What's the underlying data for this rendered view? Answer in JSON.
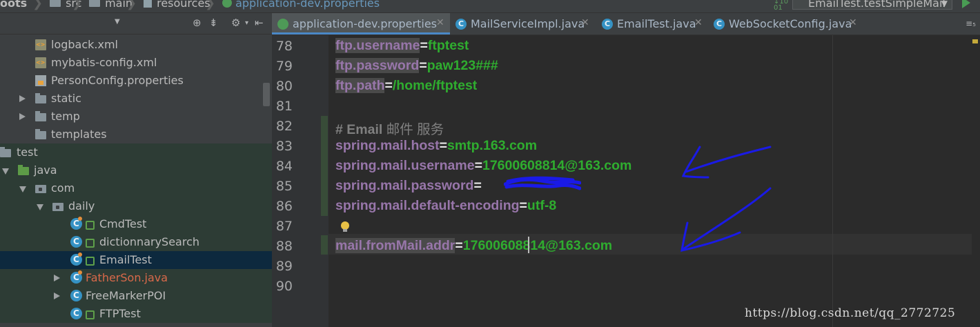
{
  "breadcrumb": {
    "items": [
      "oots",
      "src",
      "main",
      "resources",
      "application-dev.properties"
    ],
    "run_config": "EmailTest.testSimpleMail"
  },
  "project_tree": {
    "rows": [
      {
        "label": "logback.xml",
        "icon": "xml-file-icon"
      },
      {
        "label": "mybatis-config.xml",
        "icon": "xml-file-icon"
      },
      {
        "label": "PersonConfig.properties",
        "icon": "properties-file-icon"
      },
      {
        "label": "static",
        "icon": "folder-icon"
      },
      {
        "label": "temp",
        "icon": "folder-icon"
      },
      {
        "label": "templates",
        "icon": "folder-icon"
      },
      {
        "label": "test",
        "icon": "folder-icon"
      },
      {
        "label": "java",
        "icon": "source-folder-icon"
      },
      {
        "label": "com",
        "icon": "package-icon"
      },
      {
        "label": "daily",
        "icon": "package-icon"
      },
      {
        "label": "CmdTest",
        "icon": "class-icon"
      },
      {
        "label": "dictionnarySearch",
        "icon": "class-icon"
      },
      {
        "label": "EmailTest",
        "icon": "class-icon"
      },
      {
        "label": "FatherSon.java",
        "icon": "class-icon",
        "error": true
      },
      {
        "label": "FreeMarkerPOI",
        "icon": "class-icon"
      },
      {
        "label": "FTPTest",
        "icon": "class-icon"
      }
    ]
  },
  "tabs": [
    {
      "label": "application-dev.properties",
      "active": true
    },
    {
      "label": "MailServiceImpl.java",
      "active": false
    },
    {
      "label": "EmailTest.java",
      "active": false
    },
    {
      "label": "WebSocketConfig.java",
      "active": false
    }
  ],
  "editor": {
    "lines": [
      {
        "num": "78",
        "key": "ftp.username",
        "eq": "=",
        "value": "ftptest"
      },
      {
        "num": "79",
        "key": "ftp.password",
        "eq": "=",
        "value": "paw123###"
      },
      {
        "num": "80",
        "key": "ftp.path",
        "eq": "=",
        "value": "/home/ftptest"
      },
      {
        "num": "81"
      },
      {
        "num": "82",
        "comment": "# Email",
        "comment_cjk": "邮件 服务"
      },
      {
        "num": "83",
        "key": "spring.mail.host",
        "eq": "=",
        "value": "smtp.163.com"
      },
      {
        "num": "84",
        "key": "spring.mail.username",
        "eq": "=",
        "value": "17600608814@163.com"
      },
      {
        "num": "85",
        "key": "spring.mail.password",
        "eq": "=",
        "value": ""
      },
      {
        "num": "86",
        "key": "spring.mail.default-encoding",
        "eq": "=",
        "value": "utf-8"
      },
      {
        "num": "87"
      },
      {
        "num": "88",
        "key": "mail.fromMail.addr",
        "eq": "=",
        "value": "17600608814@163.com"
      },
      {
        "num": "89"
      },
      {
        "num": "90"
      }
    ],
    "watermark": "https://blog.csdn.net/qq_2772725"
  },
  "colors": {
    "key": "#9876AA",
    "value": "#2FAD2F",
    "comment": "#808080",
    "annotation": "#1A1AE6"
  }
}
